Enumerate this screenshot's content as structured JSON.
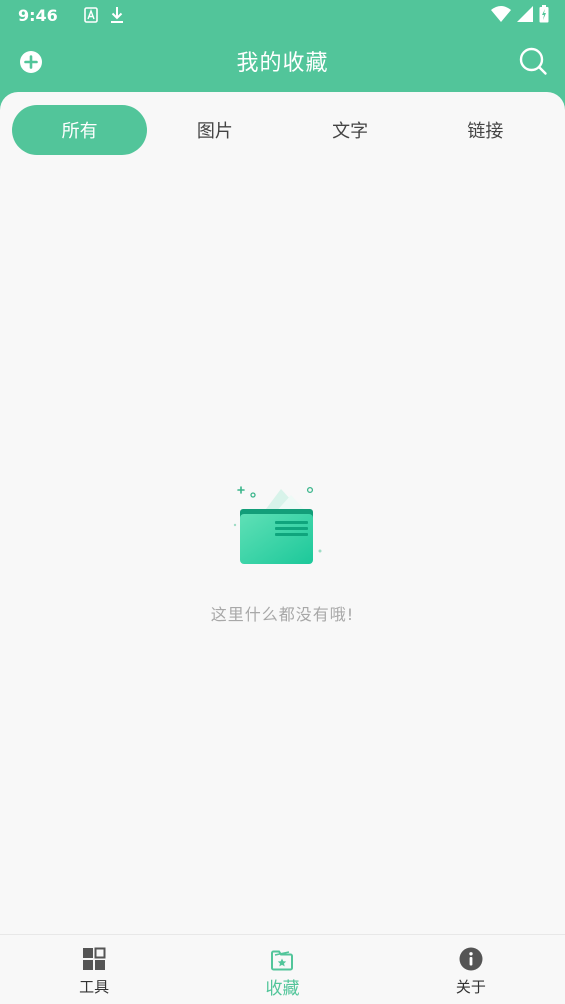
{
  "status_bar": {
    "time": "9:46"
  },
  "header": {
    "title": "我的收藏",
    "accent_color": "#52c59a"
  },
  "tabs": [
    {
      "label": "所有",
      "active": true
    },
    {
      "label": "图片",
      "active": false
    },
    {
      "label": "文字",
      "active": false
    },
    {
      "label": "链接",
      "active": false
    }
  ],
  "empty_state": {
    "message": "这里什么都没有哦!",
    "icon": "empty-folder-illustration"
  },
  "bottom_nav": [
    {
      "label": "工具",
      "icon": "grid-icon",
      "active": false
    },
    {
      "label": "收藏",
      "icon": "folder-star-icon",
      "active": true
    },
    {
      "label": "关于",
      "icon": "info-icon",
      "active": false
    }
  ]
}
